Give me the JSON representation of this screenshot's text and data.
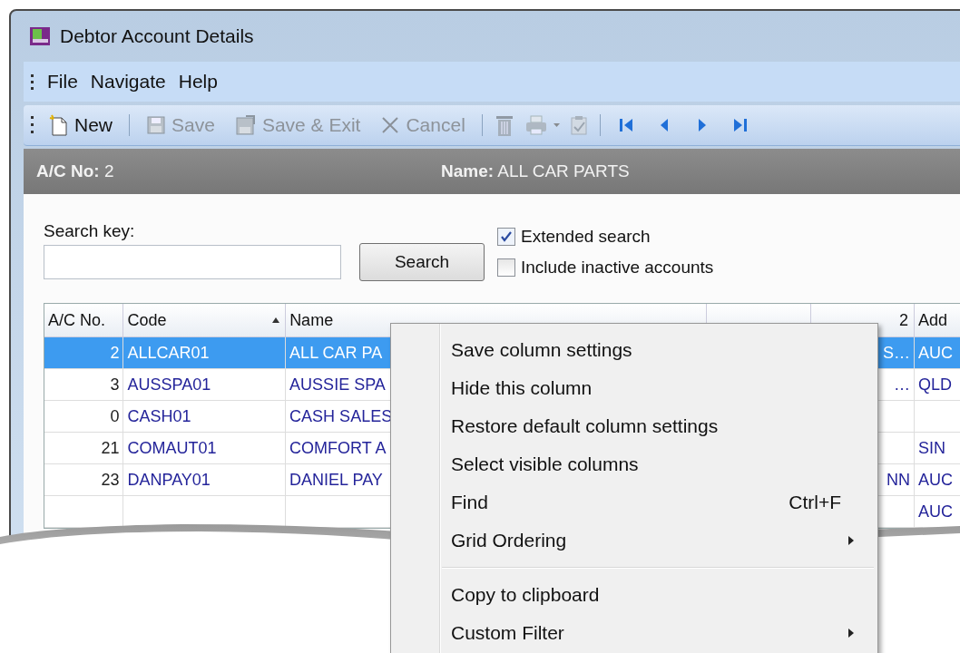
{
  "window": {
    "title": "Debtor Account Details"
  },
  "menu": [
    "File",
    "Navigate",
    "Help"
  ],
  "toolbar": [
    {
      "kind": "new",
      "label": "New",
      "disabled": false
    },
    {
      "kind": "separator"
    },
    {
      "kind": "save",
      "label": "Save",
      "disabled": true
    },
    {
      "kind": "save-exit",
      "label": "Save & Exit",
      "disabled": true
    },
    {
      "kind": "cancel",
      "label": "Cancel",
      "disabled": true
    },
    {
      "kind": "separator"
    },
    {
      "kind": "delete",
      "disabled": true
    },
    {
      "kind": "print",
      "disabled": true
    },
    {
      "kind": "report",
      "disabled": true
    },
    {
      "kind": "separator"
    },
    {
      "kind": "first",
      "disabled": false
    },
    {
      "kind": "prev",
      "disabled": false
    },
    {
      "kind": "next",
      "disabled": false
    },
    {
      "kind": "last",
      "disabled": false
    }
  ],
  "header": {
    "ac_label": "A/C No:",
    "ac_value": "2",
    "name_label": "Name:",
    "name_value": "ALL CAR PARTS"
  },
  "search": {
    "label": "Search key:",
    "button": "Search"
  },
  "checkboxes": [
    {
      "label": "Extended search",
      "checked": true
    },
    {
      "label": "Include inactive accounts",
      "checked": false
    }
  ],
  "grid": {
    "columns": [
      {
        "label": "A/C No.",
        "sorted": false
      },
      {
        "label": "Code",
        "sorted": true
      },
      {
        "label": "Name",
        "sorted": false
      },
      {
        "sorted": false
      },
      {
        "label": "2",
        "sorted": false
      },
      {
        "label": "Add",
        "sorted": false
      }
    ],
    "rows": [
      {
        "ac_no": "2",
        "code": "ALLCAR01",
        "name": "ALL CAR PA",
        "column_5": "S…",
        "column_6": "AUC",
        "selected": true
      },
      {
        "ac_no": "3",
        "code": "AUSSPA01",
        "name": "AUSSIE SPA",
        "column_5": "…",
        "column_6": "QLD",
        "selected": false
      },
      {
        "ac_no": "0",
        "code": "CASH01",
        "name": "CASH SALES",
        "selected": false
      },
      {
        "ac_no": "21",
        "code": "COMAUT01",
        "name": "COMFORT A",
        "column_6": "SIN",
        "selected": false
      },
      {
        "ac_no": "23",
        "code": "DANPAY01",
        "name": "DANIEL PAY",
        "column_5": "NN",
        "column_6": "AUC",
        "selected": false
      },
      {
        "column_6": "AUC",
        "selected": false
      }
    ]
  },
  "context_menu": [
    {
      "kind": "item",
      "label": "Save column settings"
    },
    {
      "kind": "item",
      "label": "Hide this column"
    },
    {
      "kind": "item",
      "label": "Restore default column settings"
    },
    {
      "kind": "item",
      "label": "Select visible columns"
    },
    {
      "kind": "item",
      "label": "Find",
      "shortcut": "Ctrl+F"
    },
    {
      "kind": "submenu",
      "label": "Grid Ordering"
    },
    {
      "kind": "separator"
    },
    {
      "kind": "item",
      "label": "Copy to clipboard"
    },
    {
      "kind": "submenu",
      "label": "Custom Filter"
    }
  ]
}
